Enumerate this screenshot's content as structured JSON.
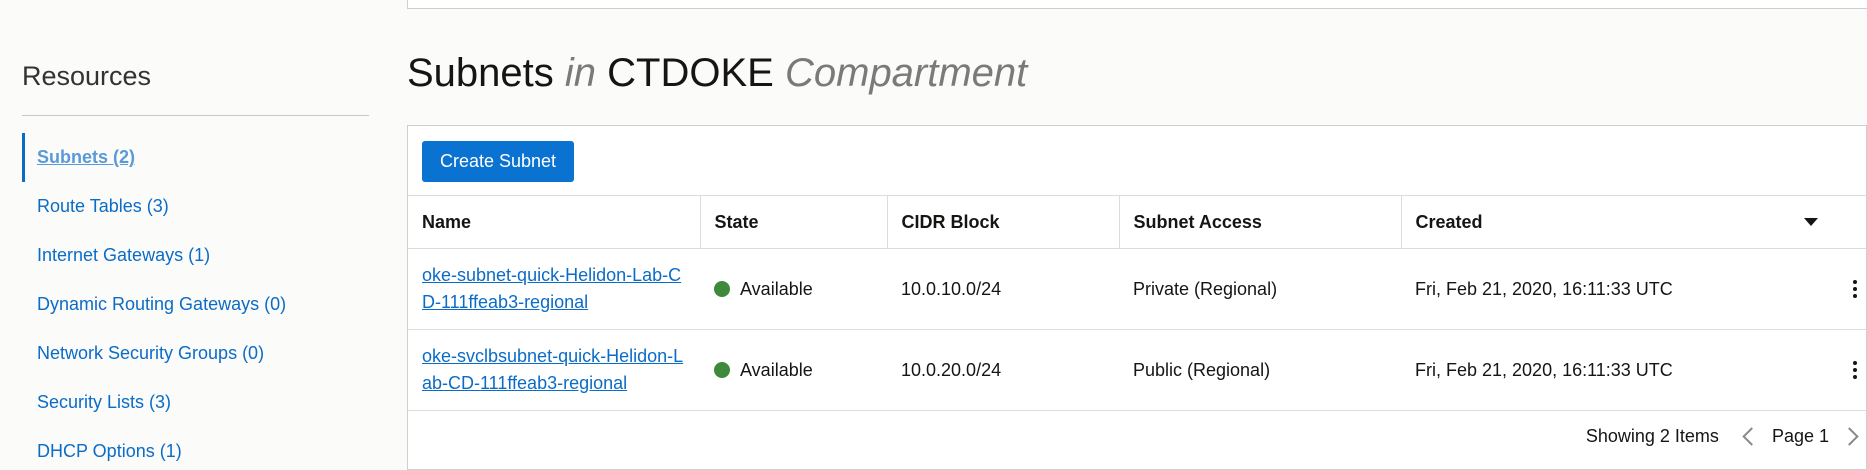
{
  "sidebar": {
    "title": "Resources",
    "items": [
      {
        "label": "Subnets (2)",
        "active": true
      },
      {
        "label": "Route Tables (3)"
      },
      {
        "label": "Internet Gateways (1)"
      },
      {
        "label": "Dynamic Routing Gateways (0)"
      },
      {
        "label": "Network Security Groups (0)"
      },
      {
        "label": "Security Lists (3)"
      },
      {
        "label": "DHCP Options (1)"
      }
    ]
  },
  "heading": {
    "resource": "Subnets",
    "in_word": "in",
    "compartment_name": "CTDOKE",
    "compartment_word": "Compartment"
  },
  "toolbar": {
    "create_label": "Create Subnet"
  },
  "table": {
    "headers": [
      "Name",
      "State",
      "CIDR Block",
      "Subnet Access",
      "Created"
    ],
    "rows": [
      {
        "name": "oke-subnet-quick-Helidon-Lab-CD-111ffeab3-regional",
        "state": "Available",
        "cidr": "10.0.10.0/24",
        "access": "Private (Regional)",
        "created": "Fri, Feb 21, 2020, 16:11:33 UTC"
      },
      {
        "name": "oke-svclbsubnet-quick-Helidon-Lab-CD-111ffeab3-regional",
        "state": "Available",
        "cidr": "10.0.20.0/24",
        "access": "Public (Regional)",
        "created": "Fri, Feb 21, 2020, 16:11:33 UTC"
      }
    ]
  },
  "pagination": {
    "showing": "Showing 2 Items",
    "page": "Page 1"
  },
  "colors": {
    "link": "#0b6cc7",
    "primary_button": "#0a72d1",
    "available_status": "#3f8a3a"
  },
  "icons": {
    "status": "status-dot-icon",
    "row_actions": "kebab-menu-icon",
    "column_menu": "caret-down-icon",
    "prev": "chevron-left-icon",
    "next": "chevron-right-icon"
  }
}
